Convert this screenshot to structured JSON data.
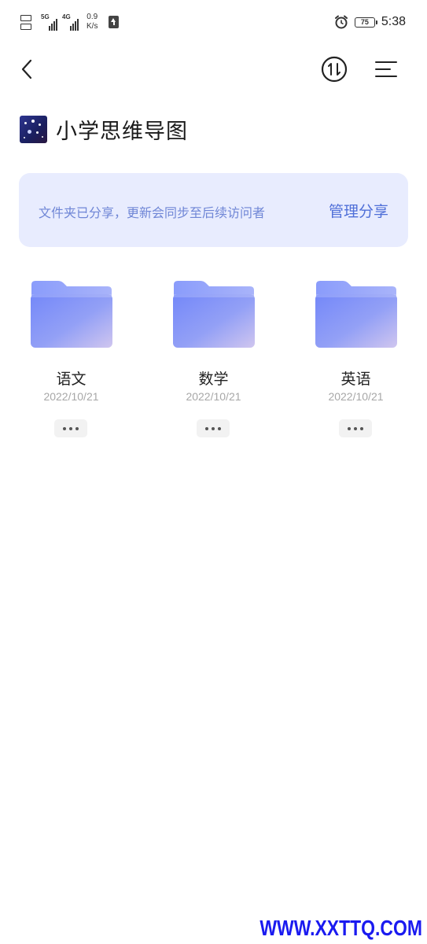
{
  "status_bar": {
    "sim1_net": "5G",
    "sim2_net": "4G",
    "net_speed_value": "0.9",
    "net_speed_unit": "K/s",
    "battery_level": "75",
    "time": "5:38"
  },
  "header": {
    "back_icon": "chevron-left-icon",
    "sort_icon": "sort-toggle-icon",
    "menu_icon": "menu-icon"
  },
  "title": {
    "text": "小学思维导图"
  },
  "share_banner": {
    "message": "文件夹已分享，更新会同步至后续访问者",
    "manage_label": "管理分享"
  },
  "folders": [
    {
      "name": "语文",
      "date": "2022/10/21"
    },
    {
      "name": "数学",
      "date": "2022/10/21"
    },
    {
      "name": "英语",
      "date": "2022/10/21"
    }
  ],
  "watermark": "WWW.XXTTQ.COM",
  "colors": {
    "banner_bg": "#e8ecfe",
    "banner_text": "#6f86d6",
    "accent": "#4f6fd8",
    "folder_start": "#7b8df8",
    "folder_end": "#cbc2f0"
  }
}
